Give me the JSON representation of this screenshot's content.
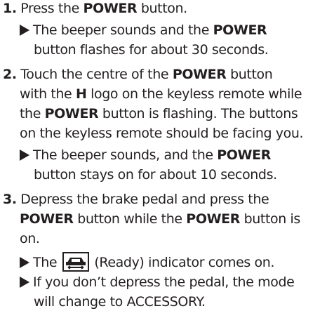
{
  "steps": [
    {
      "number": "1.",
      "lines": [
        [
          "Press the ",
          "POWER",
          " button."
        ]
      ],
      "results": [
        {
          "lines": [
            [
              "The beeper sounds and the ",
              "POWER"
            ],
            [
              "button flashes for about 30 seconds."
            ]
          ]
        }
      ]
    },
    {
      "number": "2.",
      "lines": [
        [
          "Touch the centre of the ",
          "POWER",
          " button"
        ],
        [
          "with the ",
          "H",
          " logo on the keyless remote while"
        ],
        [
          "the ",
          "POWER",
          " button is flashing. The buttons"
        ],
        [
          "on the keyless remote should be facing you."
        ]
      ],
      "results": [
        {
          "lines": [
            [
              "The beeper sounds, and the ",
              "POWER"
            ],
            [
              "button stays on for about 10 seconds."
            ]
          ]
        }
      ]
    },
    {
      "number": "3.",
      "lines": [
        [
          "Depress the brake pedal and press the"
        ],
        [
          "",
          "POWER",
          " button while the ",
          "POWER",
          " button is"
        ],
        [
          "on."
        ]
      ],
      "results": [
        {
          "pre": "The ",
          "post": " (Ready) indicator comes on.",
          "icon": "ready-indicator-icon"
        },
        {
          "lines": [
            [
              "If you don’t depress the pedal, the mode"
            ],
            [
              "will change to ACCESSORY."
            ]
          ]
        }
      ]
    }
  ]
}
